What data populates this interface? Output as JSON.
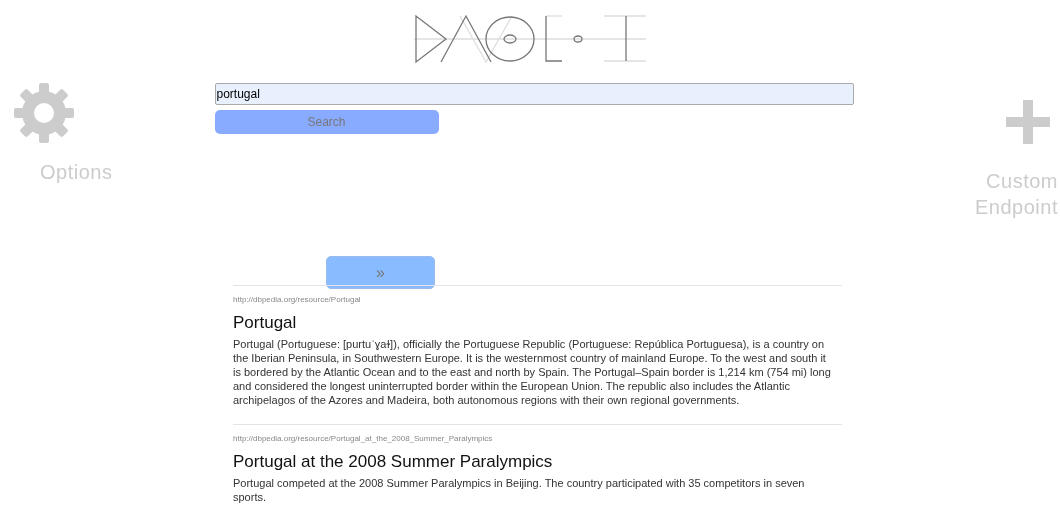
{
  "options": {
    "label": "Options"
  },
  "custom_endpoint": {
    "label": "Custom Endpoint"
  },
  "search": {
    "value": "portugal",
    "button": "Search"
  },
  "pager": {
    "next": "»"
  },
  "results": [
    {
      "url": "http://dbpedia.org/resource/Portugal",
      "title": "Portugal",
      "abstract": "Portugal (Portuguese: [purtuˈɣaɫ]), officially the Portuguese Republic (Portuguese: República Portuguesa), is a country on the Iberian Peninsula, in Southwestern Europe. It is the westernmost country of mainland Europe. To the west and south it is bordered by the Atlantic Ocean and to the east and north by Spain. The Portugal–Spain border is 1,214 km (754 mi) long and considered the longest uninterrupted border within the European Union. The republic also includes the Atlantic archipelagos of the Azores and Madeira, both autonomous regions with their own regional governments."
    },
    {
      "url": "http://dbpedia.org/resource/Portugal_at_the_2008_Summer_Paralympics",
      "title": "Portugal at the 2008 Summer Paralympics",
      "abstract": "Portugal competed at the 2008 Summer Paralympics in Beijing. The country participated with 35 competitors in seven sports."
    }
  ]
}
